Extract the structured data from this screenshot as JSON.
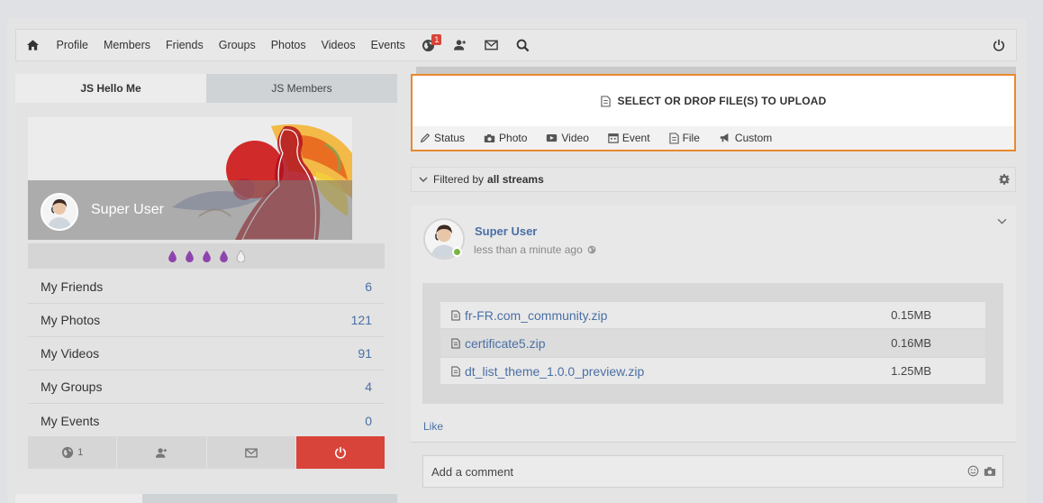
{
  "nav": {
    "links": [
      "Profile",
      "Members",
      "Friends",
      "Groups",
      "Photos",
      "Videos",
      "Events"
    ],
    "notification_count": "1"
  },
  "sidebar": {
    "tabs": [
      "JS Hello Me",
      "JS Members"
    ],
    "user_name": "Super User",
    "stats": [
      {
        "label": "My Friends",
        "count": "6"
      },
      {
        "label": "My Photos",
        "count": "121"
      },
      {
        "label": "My Videos",
        "count": "91"
      },
      {
        "label": "My Groups",
        "count": "4"
      },
      {
        "label": "My Events",
        "count": "0"
      }
    ],
    "notification_count": "1",
    "rating": {
      "filled": 4,
      "total": 5
    }
  },
  "composer": {
    "upload_label": "SELECT OR DROP FILE(S) TO UPLOAD",
    "tabs": [
      "Status",
      "Photo",
      "Video",
      "Event",
      "File",
      "Custom"
    ]
  },
  "filter": {
    "prefix": "Filtered by",
    "value": "all streams"
  },
  "post": {
    "author": "Super User",
    "time": "less than a minute ago",
    "files": [
      {
        "name": "fr-FR.com_community.zip",
        "size": "0.15MB"
      },
      {
        "name": "certificate5.zip",
        "size": "0.16MB"
      },
      {
        "name": "dt_list_theme_1.0.0_preview.zip",
        "size": "1.25MB"
      }
    ],
    "like_label": "Like",
    "comment_placeholder": "Add a comment"
  },
  "colors": {
    "accent_orange": "#e8892f",
    "link_blue": "#4a6fa5",
    "logout_red": "#d9443a",
    "drop_purple": "#8e44ad",
    "online_green": "#7cb342"
  }
}
